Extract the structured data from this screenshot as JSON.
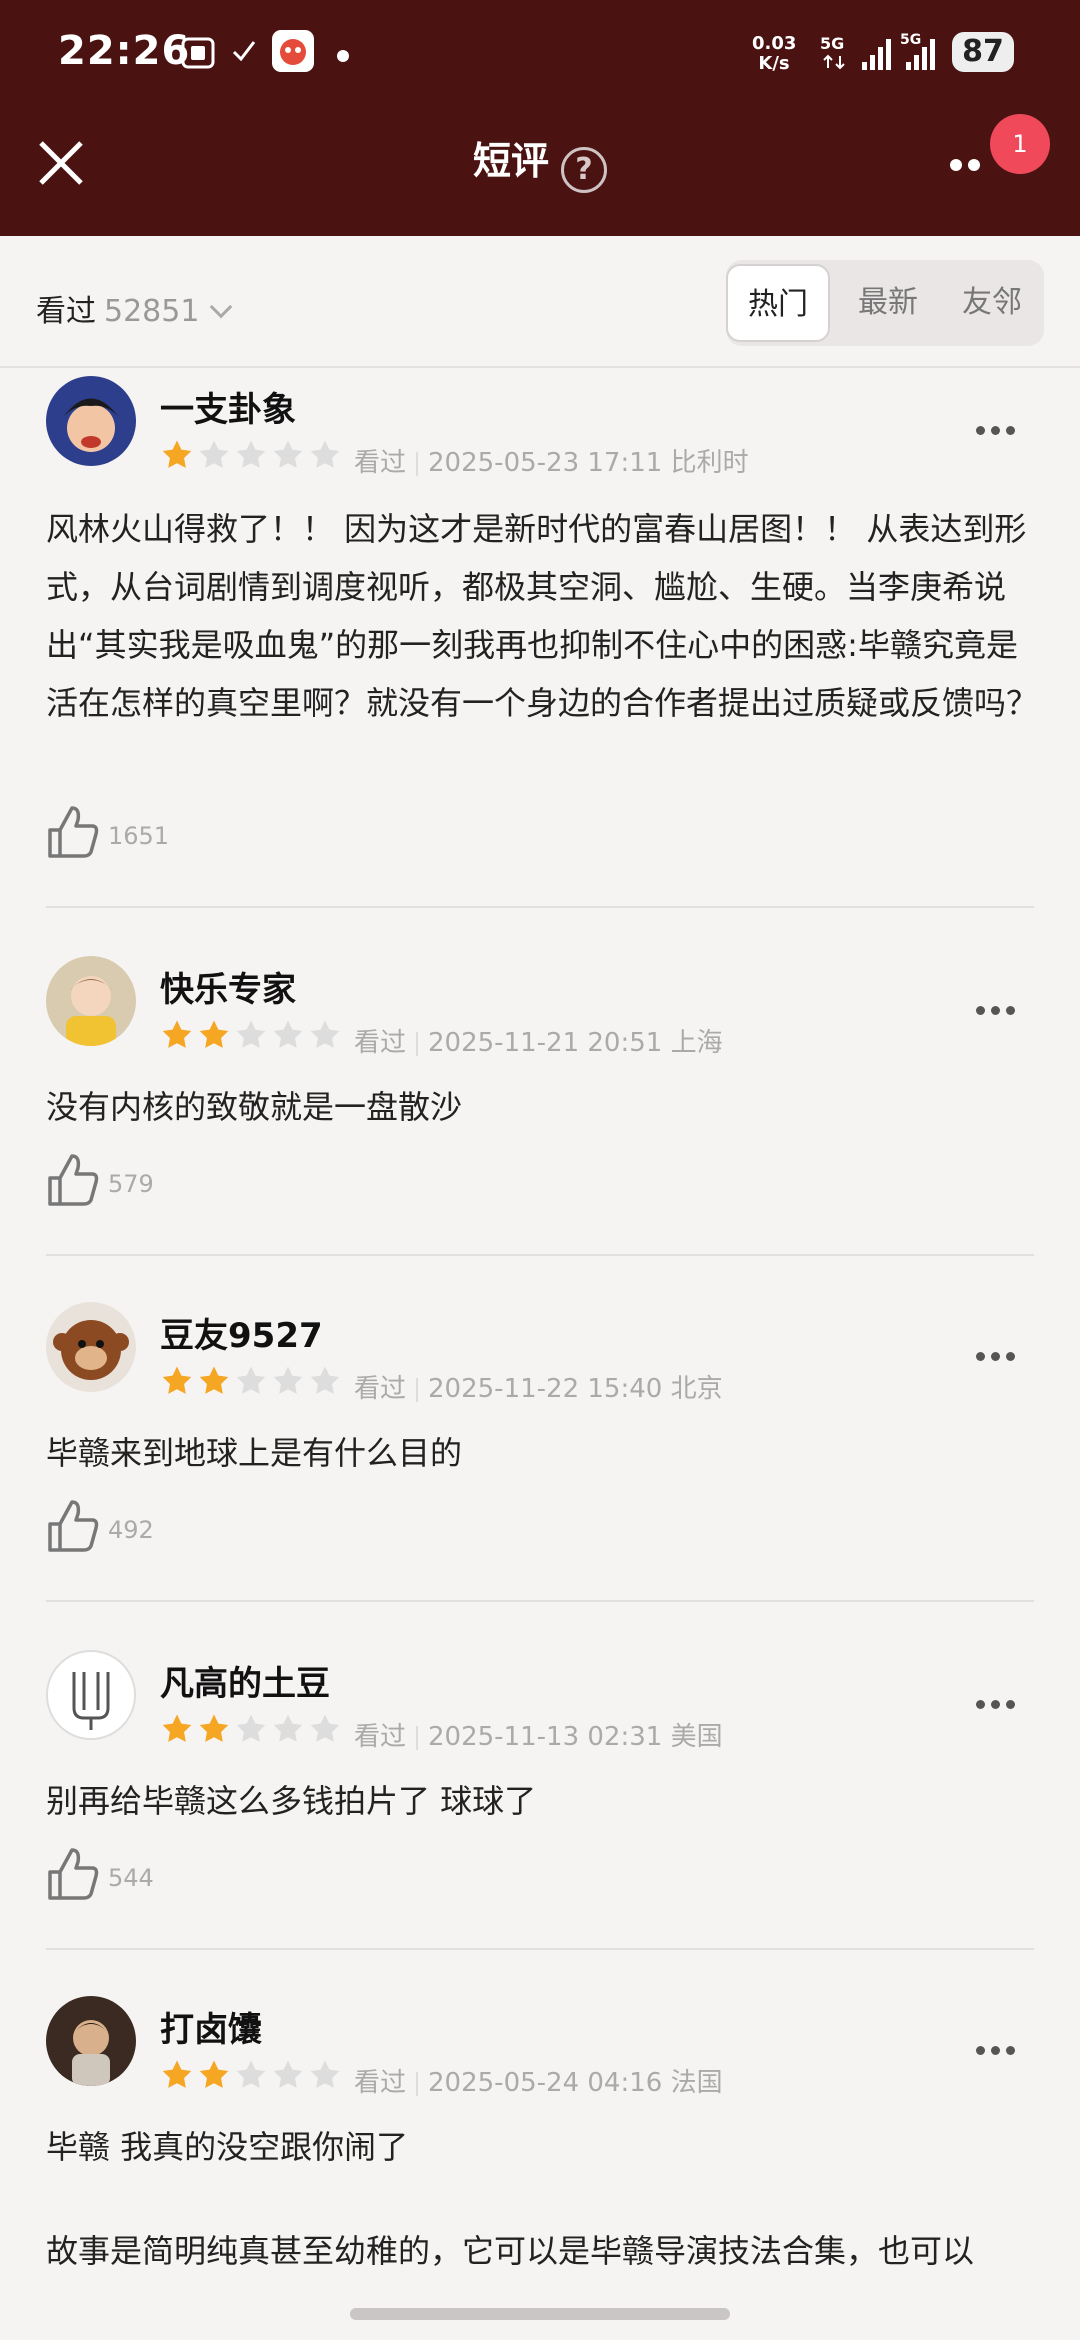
{
  "status_bar": {
    "time": "22:26",
    "net_speed_value": "0.03",
    "net_speed_unit": "K/s",
    "sim1_label": "5G",
    "sim2_label": "5G",
    "battery": "87"
  },
  "header": {
    "title": "短评",
    "help_symbol": "?",
    "notification_count": "1"
  },
  "filter": {
    "seen_label": "看过",
    "seen_count": "52851",
    "tabs": [
      {
        "label": "热门",
        "active": true
      },
      {
        "label": "最新",
        "active": false
      },
      {
        "label": "友邻",
        "active": false
      }
    ]
  },
  "reviews": [
    {
      "username": "一支卦象",
      "rating": 1,
      "status": "看过",
      "datetime": "2025-05-23 17:11",
      "location": "比利时",
      "text": "风林火山得救了！！ 因为这才是新时代的富春山居图！！ 从表达到形式，从台词剧情到调度视听，都极其空洞、尴尬、生硬。当李庚希说出“其实我是吸血鬼”的那一刻我再也抑制不住心中的困惑:毕赣究竟是活在怎样的真空里啊？就没有一个身边的合作者提出过质疑或反馈吗？",
      "likes": "1651"
    },
    {
      "username": "快乐专家",
      "rating": 2,
      "status": "看过",
      "datetime": "2025-11-21 20:51",
      "location": "上海",
      "text": "没有内核的致敬就是一盘散沙",
      "likes": "579"
    },
    {
      "username": "豆友9527",
      "rating": 2,
      "status": "看过",
      "datetime": "2025-11-22 15:40",
      "location": "北京",
      "text": "毕赣来到地球上是有什么目的",
      "likes": "492"
    },
    {
      "username": "凡高的土豆",
      "rating": 2,
      "status": "看过",
      "datetime": "2025-11-13 02:31",
      "location": "美国",
      "text": "别再给毕赣这么多钱拍片了 球球了",
      "likes": "544"
    },
    {
      "username": "打卤馕",
      "rating": 2,
      "status": "看过",
      "datetime": "2025-05-24 04:16",
      "location": "法国",
      "text": "毕赣 我真的没空跟你闹了",
      "text2": "故事是简明纯真甚至幼稚的，它可以是毕赣导演技法合集，也可以"
    }
  ],
  "colors": {
    "header_bg": "#4b1212",
    "star_filled": "#f5a623",
    "star_empty": "#dddddd",
    "badge": "#f0495a"
  }
}
